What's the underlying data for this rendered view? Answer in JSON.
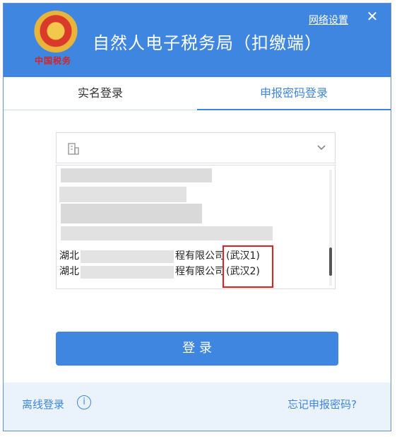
{
  "window": {
    "app_title": "自然人电子税务局（扣缴端）",
    "emblem_caption": "中国税务",
    "network_settings": "网络设置",
    "close_icon": "close-icon"
  },
  "tabs": [
    {
      "label": "实名登录",
      "active": false
    },
    {
      "label": "申报密码登录",
      "active": true
    }
  ],
  "company_select": {
    "value": "",
    "icon": "building-icon",
    "chevron": "chevron-down-icon"
  },
  "company_list": {
    "rows": [
      {
        "prefix": "湖北",
        "suffix": "程有限公司",
        "tag": "(武汉1)"
      },
      {
        "prefix": "湖北",
        "suffix": "程有限公司",
        "tag": "(武汉2)"
      }
    ]
  },
  "login_button": "登 录",
  "footer": {
    "offline_login": "离线登录",
    "info_icon": "i",
    "forgot_password": "忘记申报密码?"
  },
  "colors": {
    "accent": "#3f86e0",
    "highlight": "#e02020",
    "footer_bg": "#eaf3fc"
  }
}
